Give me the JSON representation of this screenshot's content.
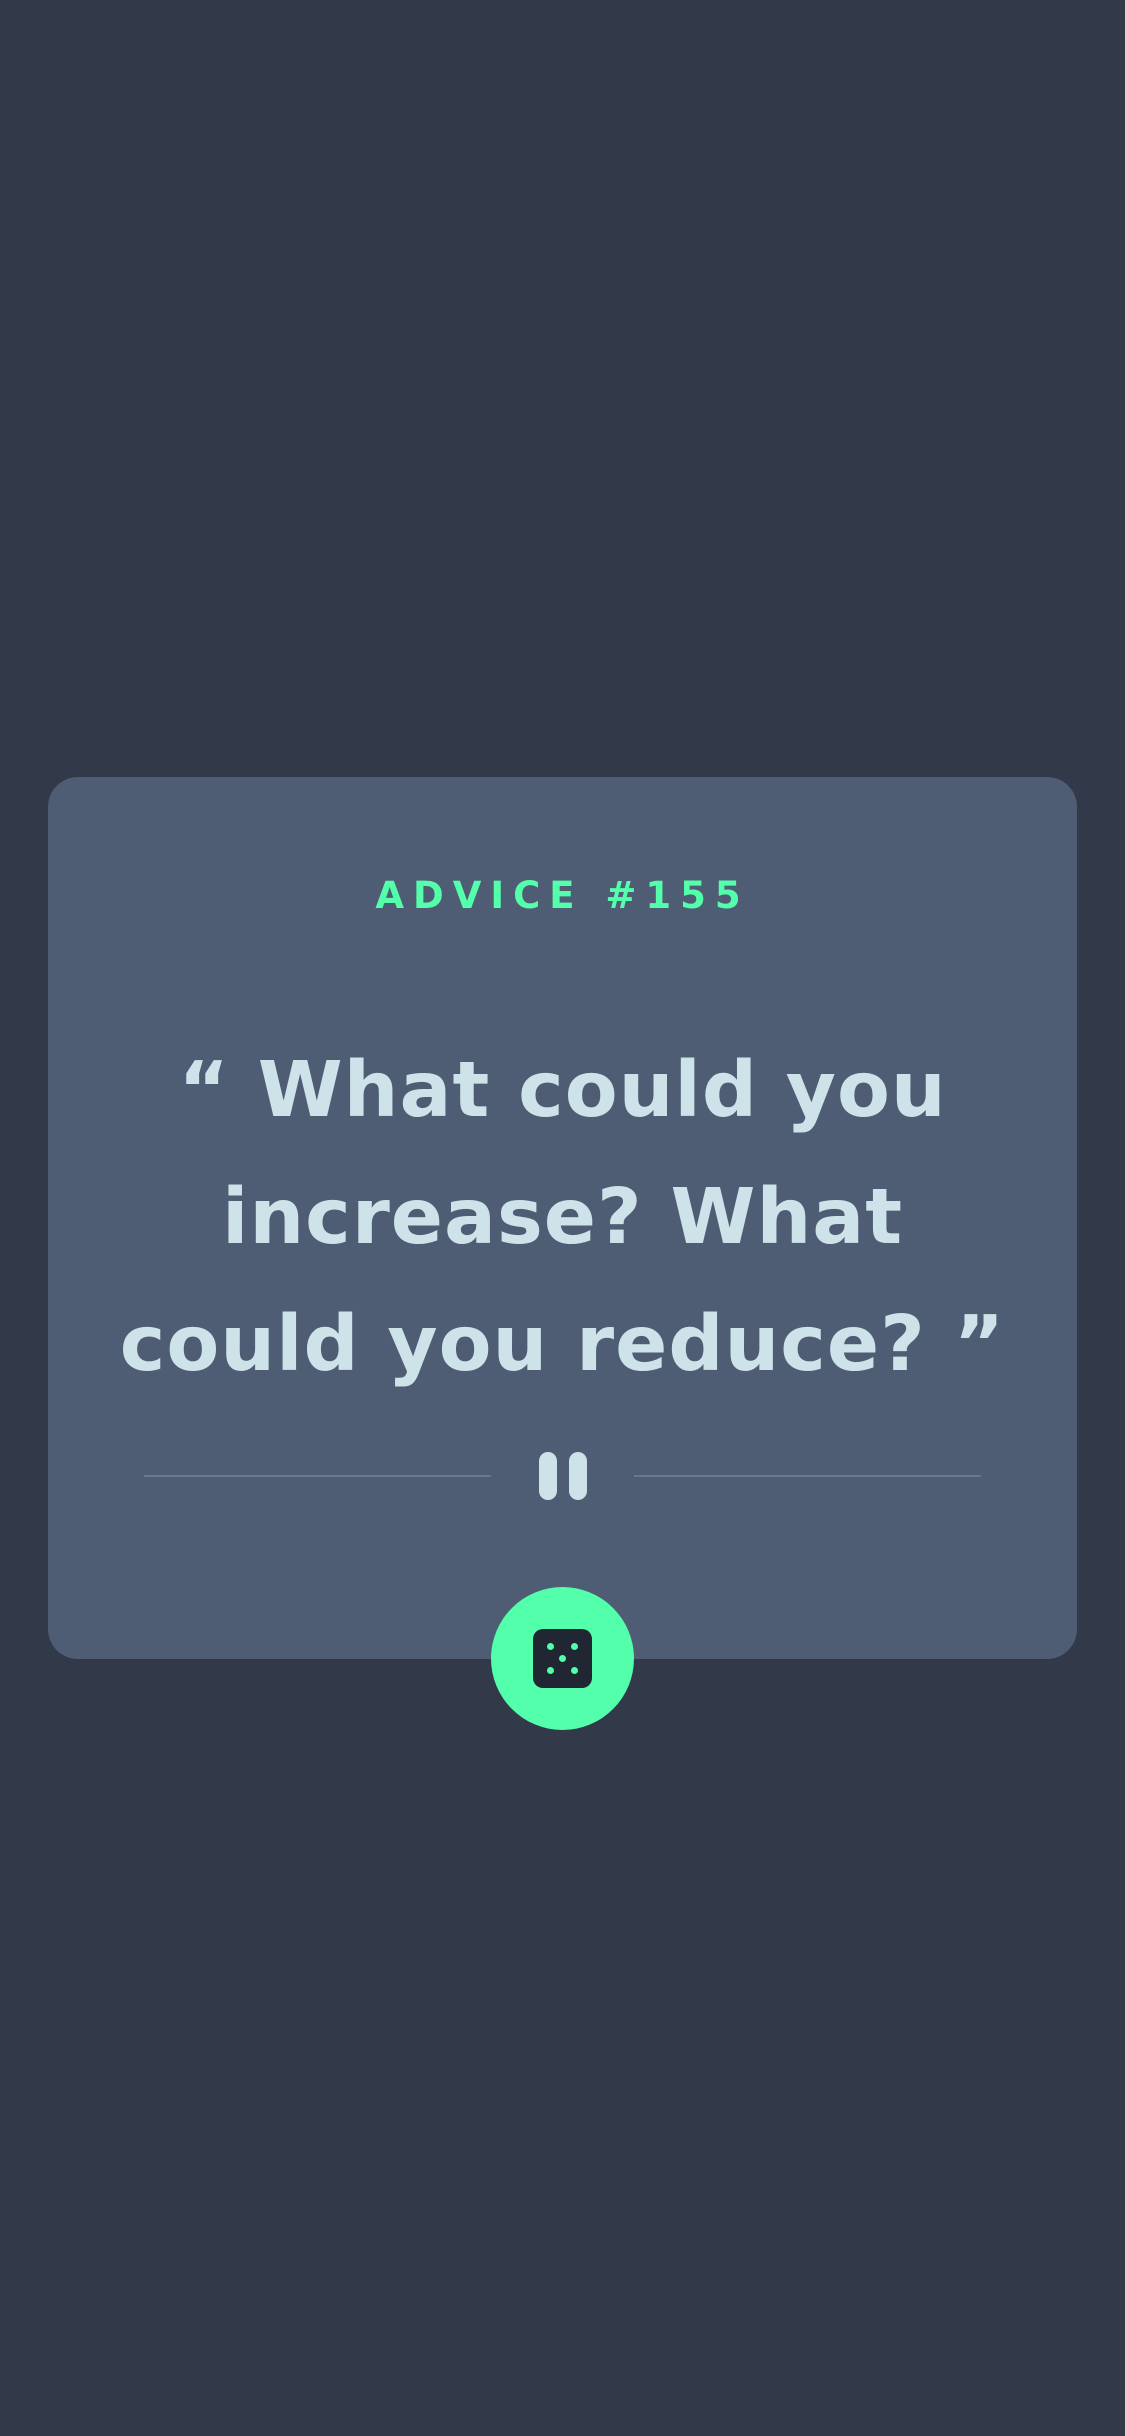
{
  "advice": {
    "label": "ADVICE #155",
    "quote": "“ What could you increase? What could you reduce? ”"
  },
  "icons": {
    "divider": "pause-icon",
    "generate": "dice-icon"
  },
  "colors": {
    "background": "#323a4a",
    "card": "#4f5d74",
    "accent": "#53ffaa",
    "text": "#cee3e9"
  }
}
